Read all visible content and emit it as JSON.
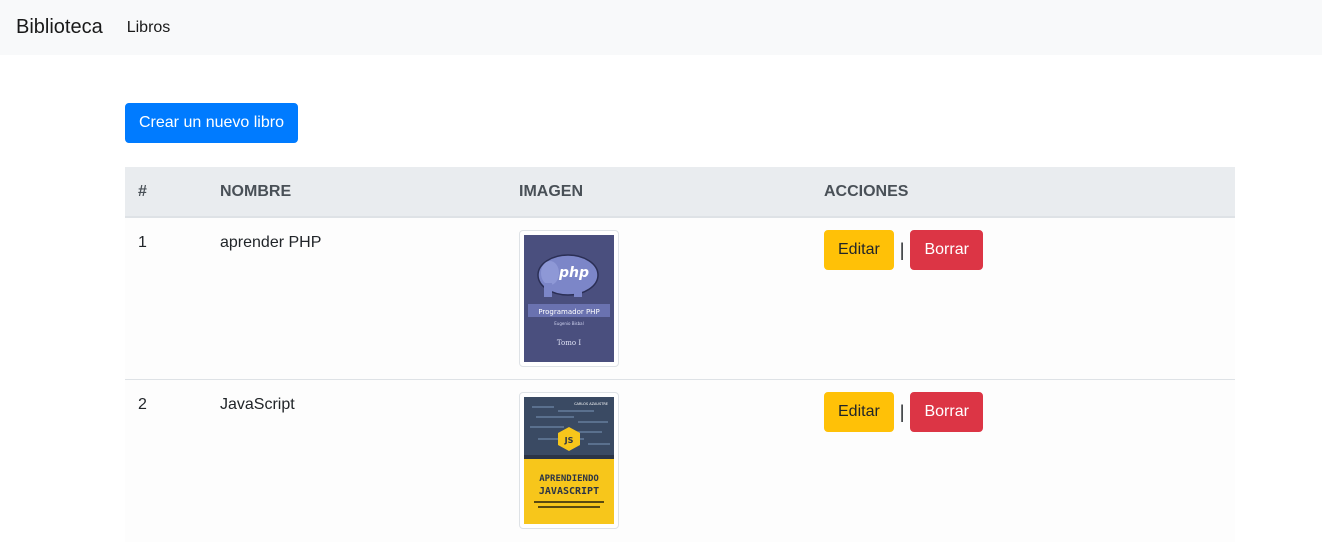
{
  "navbar": {
    "brand": "Biblioteca",
    "link": "Libros"
  },
  "create_button": "Crear un nuevo libro",
  "table": {
    "headers": [
      "#",
      "NOMBRE",
      "IMAGEN",
      "ACCIONES"
    ],
    "rows": [
      {
        "id": "1",
        "name": "aprender PHP",
        "cover": {
          "logo": "php",
          "title": "Programador PHP",
          "subtitle": "Eugenio Bisbal",
          "volume": "Tomo I"
        }
      },
      {
        "id": "2",
        "name": "JavaScript",
        "cover": {
          "badge": "JS",
          "author": "CARLOS AZAUSTRE",
          "title_line1": "APRENDIENDO",
          "title_line2": "JAVASCRIPT"
        }
      }
    ],
    "edit_label": "Editar",
    "delete_label": "Borrar",
    "separator": "|"
  },
  "colors": {
    "primary": "#007bff",
    "warning": "#ffc107",
    "danger": "#dc3545",
    "header_bg": "#e9ecef",
    "navbar_bg": "#f8f9fa"
  }
}
